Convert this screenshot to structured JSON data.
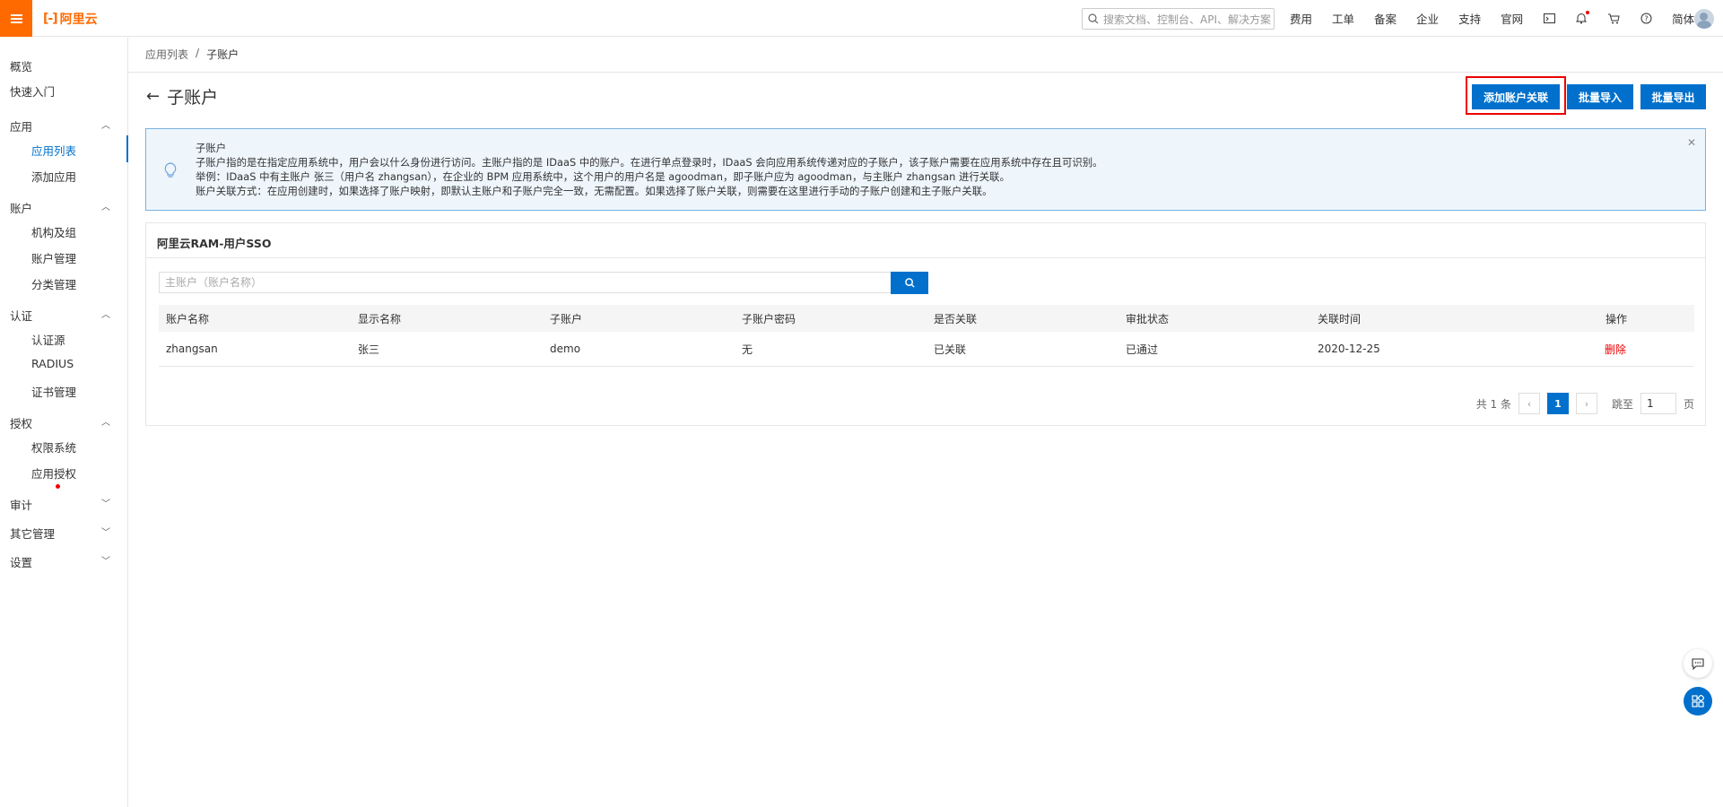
{
  "topbar": {
    "logo_text": "阿里云",
    "search_placeholder": "搜索文档、控制台、API、解决方案",
    "nav": [
      "费用",
      "工单",
      "备案",
      "企业",
      "支持",
      "官网"
    ],
    "language": "简体"
  },
  "sidebar": {
    "items": [
      {
        "label": "概览"
      },
      {
        "label": "快速入门"
      },
      {
        "label": "应用",
        "children": [
          "应用列表",
          "添加应用"
        ]
      },
      {
        "label": "账户",
        "children": [
          "机构及组",
          "账户管理",
          "分类管理"
        ]
      },
      {
        "label": "认证",
        "children": [
          "认证源",
          "RADIUS",
          "证书管理"
        ]
      },
      {
        "label": "授权",
        "children": [
          "权限系统",
          "应用授权"
        ]
      },
      {
        "label": "审计"
      },
      {
        "label": "其它管理"
      },
      {
        "label": "设置"
      }
    ],
    "active": "应用列表"
  },
  "breadcrumb": {
    "parent": "应用列表",
    "separator": "/",
    "current": "子账户"
  },
  "page": {
    "title": "子账户",
    "buttons": {
      "add_link": "添加账户关联",
      "batch_import": "批量导入",
      "batch_export": "批量导出"
    }
  },
  "notice": {
    "title": "子账户",
    "lines": [
      "子账户指的是在指定应用系统中，用户会以什么身份进行访问。主账户指的是 IDaaS 中的账户。在进行单点登录时，IDaaS 会向应用系统传递对应的子账户，该子账户需要在应用系统中存在且可识别。",
      "举例：IDaaS 中有主账户 张三（用户名 zhangsan），在企业的 BPM 应用系统中，这个用户的用户名是 agoodman，即子账户应为 agoodman，与主账户 zhangsan 进行关联。",
      "账户关联方式：在应用创建时，如果选择了账户映射，即默认主账户和子账户完全一致，无需配置。如果选择了账户关联，则需要在这里进行手动的子账户创建和主子账户关联。"
    ]
  },
  "panel": {
    "title": "阿里云RAM-用户SSO",
    "search_placeholder": "主账户（账户名称）",
    "columns": [
      "账户名称",
      "显示名称",
      "子账户",
      "子账户密码",
      "是否关联",
      "审批状态",
      "关联时间",
      "操作"
    ],
    "rows": [
      [
        "zhangsan",
        "张三",
        "demo",
        "无",
        "已关联",
        "已通过",
        "2020-12-25",
        "删除"
      ]
    ],
    "pagination": {
      "total": "共 1 条",
      "current": "1",
      "goto_label": "跳至",
      "goto_value": "1",
      "page_suffix": "页"
    }
  },
  "colors": {
    "primary": "#0070cc",
    "brand": "#ff6a00",
    "danger": "#e00000"
  }
}
